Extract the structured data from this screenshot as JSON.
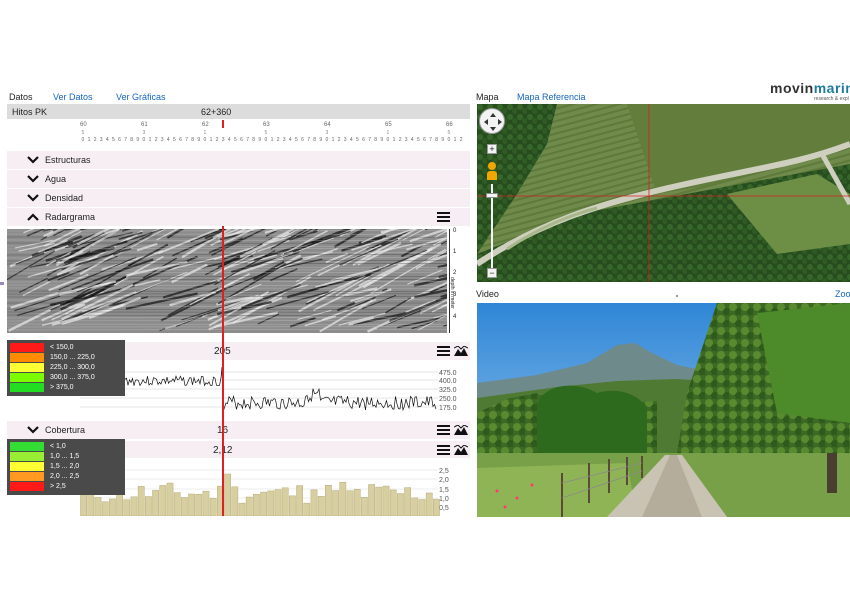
{
  "left_tabs": {
    "datos": "Datos",
    "ver_datos": "Ver Datos",
    "ver_graficas": "Ver Gráficas"
  },
  "hitos": {
    "label": "Hitos PK",
    "position": "62+360",
    "major_ticks": [
      "60",
      "61",
      "62",
      "63",
      "64",
      "65",
      "66"
    ],
    "minor_digits": "0 1 2 3 4 5 6 7 8 9"
  },
  "sections": {
    "estructuras": "Estructuras",
    "agua": "Agua",
    "densidad": "Densidad",
    "radargrama": "Radargrama",
    "cobertura": "Cobertura"
  },
  "radargrama": {
    "axis_label": "depth in meter",
    "depth_ticks": [
      "0",
      "1",
      "2",
      "3",
      "4"
    ]
  },
  "deflexion": {
    "value": "205",
    "axis_ticks": [
      "475.0",
      "400.0",
      "325.0",
      "250.0",
      "175.0"
    ],
    "legend": [
      {
        "label": "< 150,0",
        "color": "#ff1a1a"
      },
      {
        "label": "150,0 ... 225,0",
        "color": "#ff8c00"
      },
      {
        "label": "225,0 ... 300,0",
        "color": "#ffff33"
      },
      {
        "label": "300,0 ... 375,0",
        "color": "#7cfc00"
      },
      {
        "label": "> 375,0",
        "color": "#22dd22"
      }
    ]
  },
  "cobertura": {
    "value": "16",
    "bars_value": "2,12",
    "axis_ticks": [
      "2,5",
      "2,0",
      "1,5",
      "1,0",
      "0,5"
    ],
    "legend": [
      {
        "label": "< 1,0",
        "color": "#33dd33"
      },
      {
        "label": "1,0 ... 1,5",
        "color": "#99ee33"
      },
      {
        "label": "1,5 ... 2,0",
        "color": "#ffff33"
      },
      {
        "label": "2,0 ... 2,5",
        "color": "#ff9922"
      },
      {
        "label": "> 2,5",
        "color": "#ff1a1a"
      }
    ]
  },
  "right_tabs": {
    "mapa": "Mapa",
    "mapa_referencia": "Mapa Referencia"
  },
  "logo": {
    "bold": "movin",
    "accent": "marin",
    "tagline": "research & expl"
  },
  "video": {
    "label": "Video",
    "zoom": "Zoo"
  },
  "colors": {
    "accent": "#1565c0",
    "cursor": "#e02020",
    "section_bg": "#f6eef3",
    "bar": "#d8cfa0"
  }
}
